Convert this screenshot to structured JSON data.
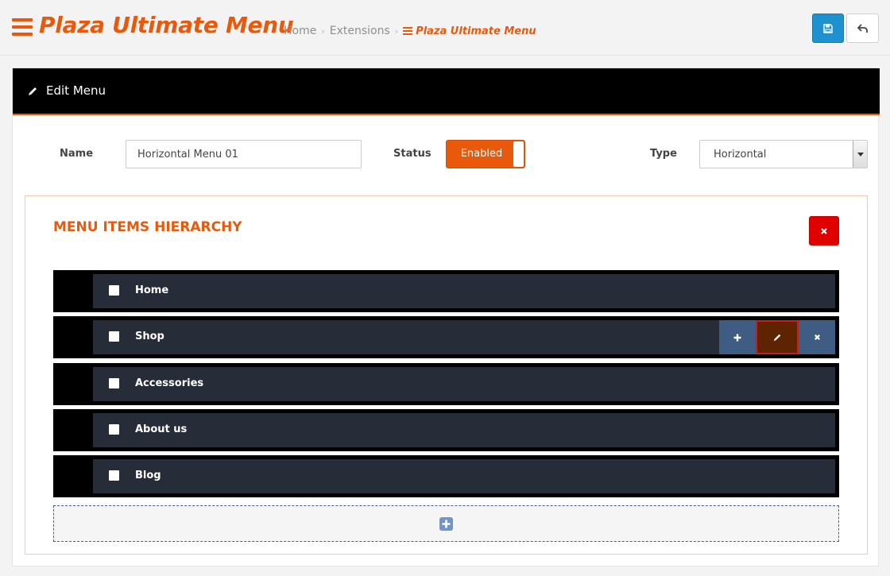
{
  "header": {
    "title": "Plaza Ultimate Menu",
    "breadcrumb": [
      "Home",
      "Extensions",
      "Plaza Ultimate Menu"
    ],
    "icons": {
      "menu": "hamburger-icon",
      "save": "save-icon",
      "back": "reply-icon"
    }
  },
  "panel": {
    "heading": "Edit Menu",
    "icon": "pencil-icon"
  },
  "form": {
    "name_label": "Name",
    "name_value": "Horizontal Menu 01",
    "status_label": "Status",
    "status_value": "Enabled",
    "type_label": "Type",
    "type_value": "Horizontal"
  },
  "hierarchy": {
    "title": "MENU ITEMS HIERARCHY",
    "items": [
      {
        "label": "Home"
      },
      {
        "label": "Shop",
        "actions": [
          "add",
          "edit",
          "delete"
        ]
      },
      {
        "label": "Accessories"
      },
      {
        "label": "About us"
      },
      {
        "label": "Blog"
      }
    ]
  },
  "colors": {
    "accent": "#e8590c",
    "primary": "#1e91cf",
    "danger": "#e00000",
    "row_bar": "#272d38",
    "action": "#3f5d83",
    "edit_active": "#5e2400"
  }
}
